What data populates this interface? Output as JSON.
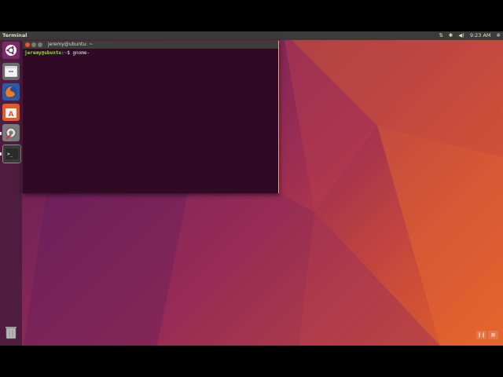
{
  "topbar": {
    "app_title": "Terminal",
    "clock": "9:23 AM",
    "indicators": [
      "network-icon",
      "bluetooth-icon",
      "volume-icon",
      "clock",
      "power-gear-icon"
    ]
  },
  "launcher": {
    "items": [
      {
        "name": "ubuntu-dash-icon"
      },
      {
        "name": "files-icon"
      },
      {
        "name": "firefox-icon"
      },
      {
        "name": "software-center-icon"
      },
      {
        "name": "system-settings-icon"
      },
      {
        "name": "terminal-icon",
        "running": true
      },
      {
        "name": "trash-icon"
      }
    ]
  },
  "terminal": {
    "title": "jeremy@ubuntu: ~",
    "prompt_user": "jeremy@ubuntu",
    "prompt_path": ":~",
    "prompt_symbol": "$ ",
    "command": "gnome-"
  },
  "colors": {
    "panel": "#3c3b37",
    "terminal_bg": "#300a24",
    "launcher": "#4b1c3e"
  }
}
